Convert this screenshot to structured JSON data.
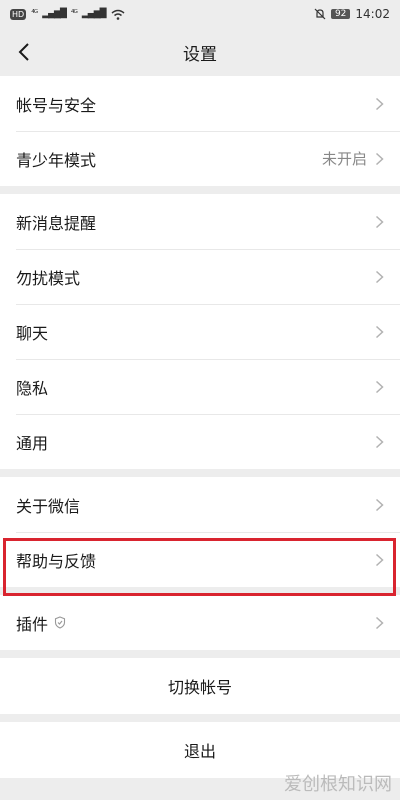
{
  "status_bar": {
    "hd": "HD",
    "net1": "⁴ᴳ",
    "net2": "⁴ᴳ",
    "battery": "92",
    "time": "14:02"
  },
  "nav": {
    "title": "设置",
    "back_icon": "chevron-left-icon"
  },
  "groups": {
    "account": {
      "items": [
        {
          "label": "帐号与安全"
        },
        {
          "label": "青少年模式",
          "value": "未开启"
        }
      ]
    },
    "notifications": {
      "items": [
        {
          "label": "新消息提醒"
        },
        {
          "label": "勿扰模式"
        },
        {
          "label": "聊天"
        },
        {
          "label": "隐私"
        },
        {
          "label": "通用"
        }
      ]
    },
    "about": {
      "items": [
        {
          "label": "关于微信"
        },
        {
          "label": "帮助与反馈",
          "highlighted": true
        }
      ]
    },
    "plugins": {
      "items": [
        {
          "label": "插件",
          "icon": "shield-icon"
        }
      ]
    }
  },
  "actions": {
    "switch_account": "切换帐号",
    "logout": "退出"
  },
  "watermark": {
    "text": "爱创根知识网"
  },
  "colors": {
    "highlight": "#d9242f",
    "background": "#ededed"
  }
}
